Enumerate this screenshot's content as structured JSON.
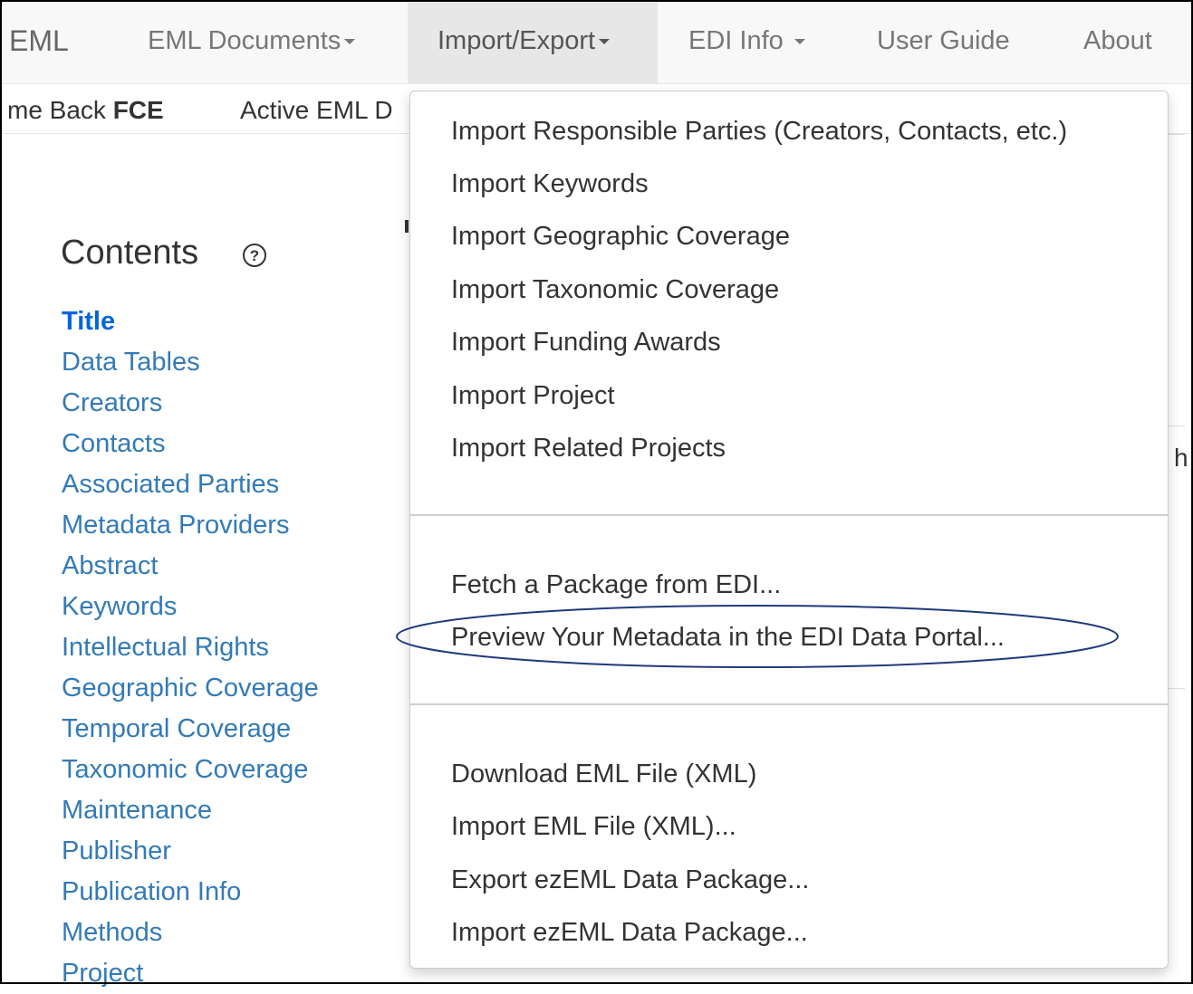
{
  "navbar": {
    "brand": "EML",
    "eml_documents": "EML Documents",
    "import_export": "Import/Export",
    "edi_info": "EDI Info",
    "user_guide": "User Guide",
    "about": "About"
  },
  "subbar": {
    "welcome_prefix": "me Back ",
    "user": "FCE",
    "active_doc": "Active EML D"
  },
  "contents": {
    "heading": "Contents",
    "help": "?",
    "items": [
      "Title",
      "Data Tables",
      "Creators",
      "Contacts",
      "Associated Parties",
      "Metadata Providers",
      "Abstract",
      "Keywords",
      "Intellectual Rights",
      "Geographic Coverage",
      "Temporal Coverage",
      "Taxonomic Coverage",
      "Maintenance",
      "Publisher",
      "Publication Info",
      "Methods",
      "Project"
    ]
  },
  "dropdown": {
    "group1": [
      "Import Responsible Parties (Creators, Contacts, etc.)",
      "Import Keywords",
      "Import Geographic Coverage",
      "Import Taxonomic Coverage",
      "Import Funding Awards",
      "Import Project",
      "Import Related Projects"
    ],
    "group2": [
      "Fetch a Package from EDI...",
      "Preview Your Metadata in the EDI Data Portal..."
    ],
    "group3": [
      "Download EML File (XML)",
      "Import EML File (XML)...",
      "Export ezEML Data Package...",
      "Import ezEML Data Package..."
    ]
  },
  "background_fragment": "h",
  "highlight_color": "#1f3a7a"
}
